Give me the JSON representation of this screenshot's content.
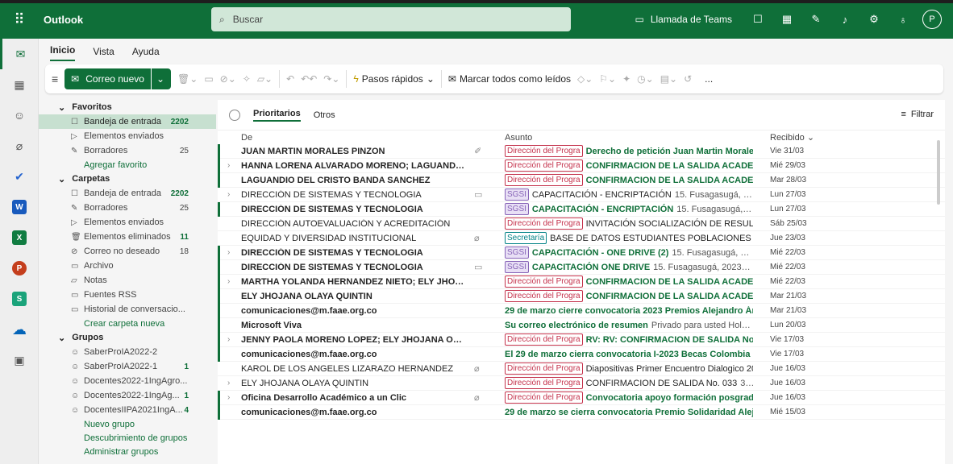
{
  "app": {
    "name": "Outlook"
  },
  "search": {
    "placeholder": "Buscar"
  },
  "topbar": {
    "teams_label": "Llamada de Teams",
    "avatar_initial": "P"
  },
  "menu_tabs": [
    "Inicio",
    "Vista",
    "Ayuda"
  ],
  "ribbon": {
    "new_mail": "Correo nuevo",
    "quick_steps": "Pasos rápidos",
    "mark_all_read": "Marcar todos como leídos",
    "more": "..."
  },
  "folders": {
    "favorites_header": "Favoritos",
    "favorites": [
      {
        "name": "Bandeja de entrada",
        "count": "2202",
        "selected": true
      },
      {
        "name": "Elementos enviados",
        "count": ""
      },
      {
        "name": "Borradores",
        "count": "25"
      }
    ],
    "add_favorite": "Agregar favorito",
    "folders_header": "Carpetas",
    "items": [
      {
        "name": "Bandeja de entrada",
        "count": "2202",
        "bold": true
      },
      {
        "name": "Borradores",
        "count": "25"
      },
      {
        "name": "Elementos enviados",
        "count": ""
      },
      {
        "name": "Elementos eliminados",
        "count": "11",
        "bold": true
      },
      {
        "name": "Correo no deseado",
        "count": "18"
      },
      {
        "name": "Archivo",
        "count": ""
      },
      {
        "name": "Notas",
        "count": ""
      },
      {
        "name": "Fuentes RSS",
        "count": ""
      },
      {
        "name": "Historial de conversacio...",
        "count": ""
      }
    ],
    "create_folder": "Crear carpeta nueva",
    "groups_header": "Grupos",
    "groups": [
      {
        "name": "SaberProIA2022-2",
        "count": ""
      },
      {
        "name": "SaberProIA2022-1",
        "count": "1",
        "bold": true
      },
      {
        "name": "Docentes2022-1IngAgro...",
        "count": ""
      },
      {
        "name": "Docentes2022-1IngAg...",
        "count": "1",
        "bold": true
      },
      {
        "name": "DocentesIIPA2021IngA...",
        "count": "4",
        "bold": true
      }
    ],
    "group_links": [
      "Nuevo grupo",
      "Descubrimiento de grupos",
      "Administrar grupos"
    ]
  },
  "list": {
    "tabs": [
      "Prioritarios",
      "Otros"
    ],
    "filter": "Filtrar",
    "col_from": "De",
    "col_subject": "Asunto",
    "col_received": "Recibido",
    "rows": [
      {
        "from": "JUAN MARTIN MORALES PINZON",
        "tag": "Dirección del Progra",
        "title": "Derecho de petición Juan Martin Morales P",
        "preview": "",
        "date": "Vie 31/03",
        "unread": true,
        "icon": "✐"
      },
      {
        "from": "HANNA LORENA ALVARADO MORENO; LAGUANDIO DE...",
        "tag": "Dirección del Progra",
        "title": "CONFIRMACION DE LA SALIDA ACADEMIC",
        "preview": "",
        "date": "Mié 29/03",
        "unread": true,
        "expand": true
      },
      {
        "from": "LAGUANDIO DEL CRISTO BANDA SANCHEZ",
        "tag": "Dirección del Progra",
        "title": "CONFIRMACION DE LA SALIDA ACADEMIC",
        "preview": "",
        "date": "Mar 28/03",
        "unread": true
      },
      {
        "from": "DIRECCIÓN DE SISTEMAS Y TECNOLOGIA",
        "tag": "SGSI",
        "title": "CAPACITACIÓN - ENCRIPTACIÓN",
        "preview": "15. Fusagasugá, 202...",
        "date": "Lun 27/03",
        "unread": false,
        "expand": true,
        "icon": "▭"
      },
      {
        "from": "DIRECCIÓN DE SISTEMAS Y TECNOLOGIA",
        "tag": "SGSI",
        "title": "CAPACITACIÓN - ENCRIPTACIÓN",
        "preview": "15. Fusagasugá, 202...",
        "date": "Lun 27/03",
        "unread": true
      },
      {
        "from": "DIRECCIÓN AUTOEVALUACIÓN Y ACREDITACIÓN",
        "tag": "Dirección del Progra",
        "title": "INVITACIÓN SOCIALIZACIÓN DE RESULTADC",
        "preview": "",
        "date": "Sáb 25/03",
        "unread": false
      },
      {
        "from": "EQUIDAD Y DIVERSIDAD INSTITUCIONAL",
        "tag": "Secretaría",
        "title": "BASE DE DATOS ESTUDIANTES POBLACIONES PRIORI",
        "preview": "",
        "date": "Jue 23/03",
        "unread": false,
        "icon": "⌀"
      },
      {
        "from": "DIRECCIÓN DE SISTEMAS Y TECNOLOGIA",
        "tag": "SGSI",
        "title": "CAPACITACIÓN - ONE DRIVE (2)",
        "preview": "15. Fusagasugá, 202...",
        "date": "Mié 22/03",
        "unread": true,
        "expand": true
      },
      {
        "from": "DIRECCIÓN DE SISTEMAS Y TECNOLOGIA",
        "tag": "SGSI",
        "title": "CAPACITACIÓN ONE DRIVE",
        "preview": "15. Fusagasugá, 2023-03-...",
        "date": "Mié 22/03",
        "unread": true,
        "icon": "▭"
      },
      {
        "from": "MARTHA YOLANDA HERNANDEZ NIETO; ELY JHOJANA ...",
        "tag": "Dirección del Progra",
        "title": "CONFIRMACION DE LA SALIDA ACADEMIC",
        "preview": "",
        "date": "Mié 22/03",
        "unread": true,
        "expand": true
      },
      {
        "from": "ELY JHOJANA OLAYA QUINTIN",
        "tag": "Dirección del Progra",
        "title": "CONFIRMACION DE LA SALIDA ACADEMIC",
        "preview": "",
        "date": "Mar 21/03",
        "unread": true
      },
      {
        "from": "comunicaciones@m.faae.org.co",
        "tag": "",
        "title": "29 de marzo cierre convocatoria 2023 Premios Alejandro Ánge...",
        "preview": "",
        "date": "Mar 21/03",
        "unread": true
      },
      {
        "from": "Microsoft Viva",
        "tag": "",
        "title": "Su correo electrónico de resumen",
        "preview": "Privado para usted Hola, Pr...",
        "date": "Lun 20/03",
        "unread": true
      },
      {
        "from": "JENNY PAOLA MORENO LOPEZ; ELY JHOJANA OLAYA Q...",
        "tag": "Dirección del Progra",
        "title": "RV: RV: CONFIRMACION DE SALIDA No. 03",
        "preview": "",
        "date": "Vie 17/03",
        "unread": true,
        "expand": true
      },
      {
        "from": "comunicaciones@m.faae.org.co",
        "tag": "",
        "title": "El 29 de marzo cierra convocatoria I-2023 Becas Colombia Bio...",
        "preview": "",
        "date": "Vie 17/03",
        "unread": true
      },
      {
        "from": "KAROL DE LOS ANGELES LIZARAZO HERNANDEZ",
        "tag": "Dirección del Progra",
        "title": "Diapositivas Primer Encuentro Dialogico 20.",
        "preview": "",
        "date": "Jue 16/03",
        "unread": false,
        "icon": "⌀"
      },
      {
        "from": "ELY JHOJANA OLAYA QUINTIN",
        "tag": "Dirección del Progra",
        "title": "CONFIRMACION DE SALIDA No. 033",
        "preview": "32...",
        "date": "Jue 16/03",
        "unread": false,
        "expand": true
      },
      {
        "from": "Oficina Desarrollo Académico a un Clic",
        "tag": "Dirección del Progra",
        "title": "Convocatoria apoyo formación posgradual",
        "preview": "",
        "date": "Jue 16/03",
        "unread": true,
        "expand": true,
        "icon": "⌀"
      },
      {
        "from": "comunicaciones@m.faae.org.co",
        "tag": "",
        "title": "29 de marzo se cierra convocatoria Premio Solidaridad Alejan...",
        "preview": "",
        "date": "Mié 15/03",
        "unread": true
      }
    ]
  },
  "colors": {
    "brand": "#0f6f39",
    "tag_red": "#c4314b",
    "tag_purple": "#8764b8",
    "tag_teal": "#038387"
  }
}
